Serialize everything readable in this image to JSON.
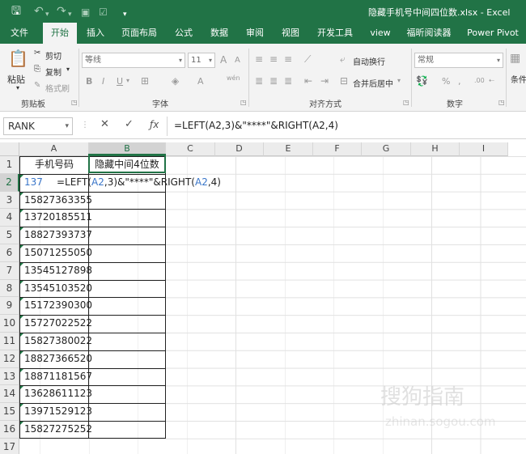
{
  "titlebar": {
    "title": "隐藏手机号中间四位数.xlsx  -  Excel"
  },
  "tabs": [
    {
      "label": "文件"
    },
    {
      "label": "开始"
    },
    {
      "label": "插入"
    },
    {
      "label": "页面布局"
    },
    {
      "label": "公式"
    },
    {
      "label": "数据"
    },
    {
      "label": "审阅"
    },
    {
      "label": "视图"
    },
    {
      "label": "开发工具"
    },
    {
      "label": "view"
    },
    {
      "label": "福昕阅读器"
    },
    {
      "label": "Power Pivot"
    }
  ],
  "ribbon": {
    "clipboard": {
      "paste": "粘贴",
      "cut": "剪切",
      "copy": "复制",
      "format_painter": "格式刷",
      "group": "剪贴板"
    },
    "font": {
      "name": "等线",
      "size": "11",
      "group": "字体",
      "bold": "B",
      "italic": "I",
      "underline": "U",
      "grow": "A",
      "shrink": "A",
      "font_color": "A",
      "wen": "wén"
    },
    "alignment": {
      "wrap": "自动换行",
      "merge": "合并后居中",
      "group": "对齐方式"
    },
    "number": {
      "format": "常规",
      "percent": "%",
      "comma": ",",
      "group": "数字",
      "decimals": ".00"
    },
    "styles": {
      "conditional": "条件"
    }
  },
  "formula_bar": {
    "name_box": "RANK",
    "formula": "=LEFT(A2,3)&\"****\"&RIGHT(A2,4)"
  },
  "columns": [
    "A",
    "B",
    "C",
    "D",
    "E",
    "F",
    "G",
    "H",
    "I"
  ],
  "rows": [
    "1",
    "2",
    "3",
    "4",
    "5",
    "6",
    "7",
    "8",
    "9",
    "10",
    "11",
    "12",
    "13",
    "14",
    "15",
    "16",
    "17"
  ],
  "sheet": {
    "header_a": "手机号码",
    "header_b": "隐藏中间4位数",
    "a2_visible": "137",
    "edit_parts": {
      "p1": "=LEFT(",
      "r1": "A2",
      "p2": ",3)&\"****\"&RIGHT(",
      "r2": "A2",
      "p3": ",4)"
    },
    "phones": [
      "15827363355",
      "13720185511",
      "18827393737",
      "15071255050",
      "13545127898",
      "13545103520",
      "15172390300",
      "15727022522",
      "15827380022",
      "18827366520",
      "18871181567",
      "13628611123",
      "13971529123",
      "15827275252"
    ]
  },
  "watermark": {
    "line1": "搜狗指南",
    "line2": "zhinan.sogou.com"
  },
  "colors": {
    "excel_green": "#217346",
    "ref_blue": "#3a76c9"
  }
}
